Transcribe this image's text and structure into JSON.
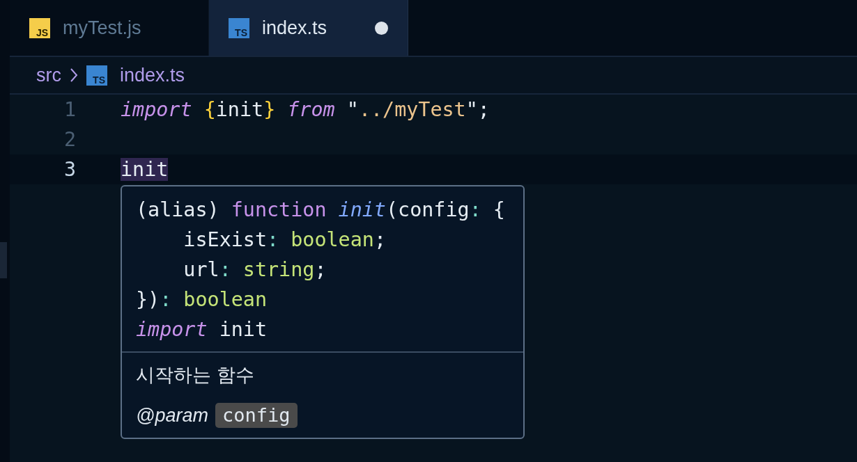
{
  "tabs": [
    {
      "label": "myTest.js",
      "icon": {
        "kind": "js",
        "text": "JS"
      },
      "selected": false,
      "modified": false
    },
    {
      "label": "index.ts",
      "icon": {
        "kind": "ts",
        "text": "TS"
      },
      "selected": true,
      "modified": true
    }
  ],
  "breadcrumb": [
    {
      "label": "src"
    },
    {
      "label": "index.ts",
      "icon": {
        "kind": "ts",
        "text": "TS"
      }
    }
  ],
  "lines": [
    {
      "number": "1",
      "current": false,
      "tokens": [
        {
          "kind": "keyword",
          "text": "import"
        },
        {
          "kind": "brace",
          "text": " {"
        },
        {
          "kind": "plain",
          "text": "init"
        },
        {
          "kind": "brace",
          "text": "}"
        },
        {
          "kind": "keyword",
          "text": " from"
        },
        {
          "kind": "plain",
          "text": " \""
        },
        {
          "kind": "string",
          "text": "../myTest"
        },
        {
          "kind": "plain",
          "text": "\";"
        }
      ]
    },
    {
      "number": "2",
      "current": false
    },
    {
      "number": "3",
      "current": true,
      "tokens": [
        {
          "kind": "match",
          "text": "init"
        }
      ]
    }
  ],
  "hover": {
    "signature": [
      [
        {
          "kind": "plain",
          "text": "(alias) "
        },
        {
          "kind": "storage",
          "text": "function"
        },
        {
          "kind": "fn",
          "text": " init"
        },
        {
          "kind": "plain",
          "text": "(config"
        },
        {
          "kind": "colon",
          "text": ":"
        },
        {
          "kind": "plain",
          "text": " {"
        }
      ],
      [
        {
          "kind": "plain",
          "text": "    isExist"
        },
        {
          "kind": "colon",
          "text": ":"
        },
        {
          "kind": "type",
          "text": " boolean"
        },
        {
          "kind": "plain",
          "text": ";"
        }
      ],
      [
        {
          "kind": "plain",
          "text": "    url"
        },
        {
          "kind": "colon",
          "text": ":"
        },
        {
          "kind": "type",
          "text": " string"
        },
        {
          "kind": "plain",
          "text": ";"
        }
      ],
      [
        {
          "kind": "plain",
          "text": "})"
        },
        {
          "kind": "colon",
          "text": ":"
        },
        {
          "kind": "type",
          "text": " boolean"
        }
      ],
      [
        {
          "kind": "keyword",
          "text": "import"
        },
        {
          "kind": "plain",
          "text": " init"
        }
      ]
    ],
    "description": "시작하는 함수",
    "param_tag": "@param",
    "param_name": "config"
  }
}
